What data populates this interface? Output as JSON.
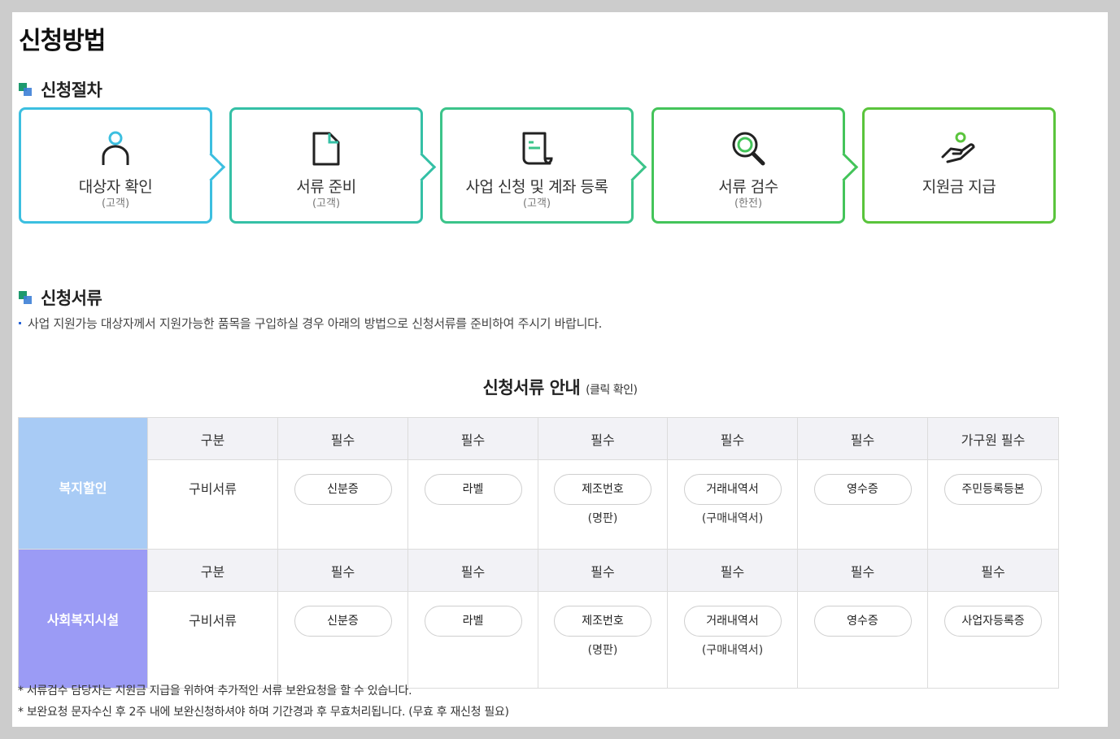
{
  "page_title": "신청방법",
  "procedure": {
    "title": "신청절차",
    "steps": [
      {
        "label": "대상자 확인",
        "sub": "(고객)",
        "icon": "person-icon",
        "color": "#3cbfe0"
      },
      {
        "label": "서류 준비",
        "sub": "(고객)",
        "icon": "document-icon",
        "color": "#35c0a6"
      },
      {
        "label": "사업 신청 및 계좌 등록",
        "sub": "(고객)",
        "icon": "scroll-icon",
        "color": "#3cc48a"
      },
      {
        "label": "서류 검수",
        "sub": "(한전)",
        "icon": "magnifier-icon",
        "color": "#44c45a"
      },
      {
        "label": "지원금 지급",
        "sub": "",
        "icon": "hand-coin-icon",
        "color": "#5ac43c"
      }
    ]
  },
  "documents": {
    "title": "신청서류",
    "description": "사업 지원가능 대상자께서 지원가능한 품목을 구입하실 경우 아래의 방법으로 신청서류를 준비하여 주시기 바랍니다.",
    "table_title": "신청서류 안내",
    "table_title_small": "(클릭 확인)",
    "tables": [
      {
        "category": "복지할인",
        "category_color": "#a8cbf5",
        "header": [
          "구분",
          "필수",
          "필수",
          "필수",
          "필수",
          "필수",
          "가구원 필수"
        ],
        "row_label": "구비서류",
        "docs": [
          {
            "label": "신분증",
            "sub": ""
          },
          {
            "label": "라벨",
            "sub": ""
          },
          {
            "label": "제조번호",
            "sub": "(명판)"
          },
          {
            "label": "거래내역서",
            "sub": "(구매내역서)"
          },
          {
            "label": "영수증",
            "sub": ""
          },
          {
            "label": "주민등록등본",
            "sub": ""
          }
        ]
      },
      {
        "category": "사회복지시설",
        "category_color": "#9b9bf5",
        "header": [
          "구분",
          "필수",
          "필수",
          "필수",
          "필수",
          "필수",
          "필수"
        ],
        "row_label": "구비서류",
        "docs": [
          {
            "label": "신분증",
            "sub": ""
          },
          {
            "label": "라벨",
            "sub": ""
          },
          {
            "label": "제조번호",
            "sub": "(명판)"
          },
          {
            "label": "거래내역서",
            "sub": "(구매내역서)"
          },
          {
            "label": "영수증",
            "sub": ""
          },
          {
            "label": "사업자등록증",
            "sub": ""
          }
        ]
      }
    ],
    "notes": [
      "* 서류검수 담당자는 지원금 지급을 위하여 추가적인 서류 보완요청을 할 수 있습니다.",
      "* 보완요청 문자수신 후 2주 내에 보완신청하셔야 하며 기간경과 후 무효처리됩니다. (무효 후 재신청 필요)"
    ]
  }
}
